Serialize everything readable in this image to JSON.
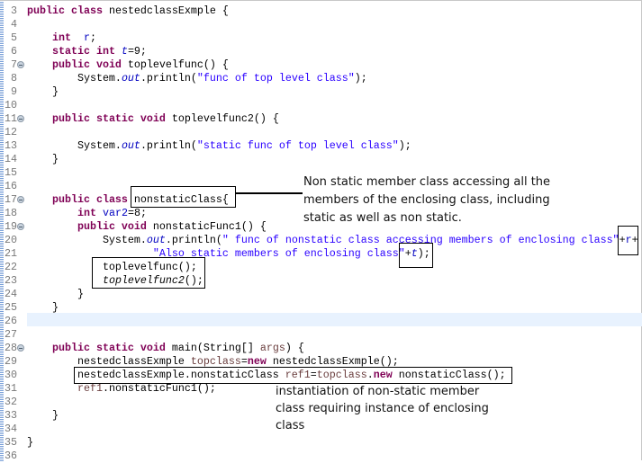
{
  "editor": {
    "highlighted_line": 26,
    "lines": [
      {
        "n": 3,
        "fold": false,
        "tokens": [
          [
            "kw",
            "public class"
          ],
          [
            "",
            "nestedclassExmple {"
          ]
        ]
      },
      {
        "n": 4,
        "fold": false,
        "tokens": []
      },
      {
        "n": 5,
        "fold": false,
        "tokens": [
          [
            "",
            "    "
          ],
          [
            "kw",
            "int"
          ],
          [
            "",
            ""
          ],
          [
            "fld",
            " r"
          ],
          [
            "",
            ";"
          ]
        ]
      },
      {
        "n": 6,
        "fold": false,
        "tokens": [
          [
            "",
            "    "
          ],
          [
            "kw",
            "static int"
          ],
          [
            "sfld",
            " t"
          ],
          [
            "",
            "=9;"
          ]
        ]
      },
      {
        "n": 7,
        "fold": true,
        "tokens": [
          [
            "",
            "    "
          ],
          [
            "kw",
            "public void"
          ],
          [
            "",
            " toplevelfunc() {"
          ]
        ]
      },
      {
        "n": 8,
        "fold": false,
        "tokens": [
          [
            "",
            "        System."
          ],
          [
            "sfld",
            "out"
          ],
          [
            "",
            ".println("
          ],
          [
            "str",
            "\"func of top level class\""
          ],
          [
            "",
            ");"
          ]
        ]
      },
      {
        "n": 9,
        "fold": false,
        "tokens": [
          [
            "",
            "    }"
          ]
        ]
      },
      {
        "n": 10,
        "fold": false,
        "tokens": []
      },
      {
        "n": 11,
        "fold": true,
        "tokens": [
          [
            "",
            "    "
          ],
          [
            "kw",
            "public static void"
          ],
          [
            "",
            " toplevelfunc2() {"
          ]
        ]
      },
      {
        "n": 12,
        "fold": false,
        "tokens": []
      },
      {
        "n": 13,
        "fold": false,
        "tokens": [
          [
            "",
            "        System."
          ],
          [
            "sfld",
            "out"
          ],
          [
            "",
            ".println("
          ],
          [
            "str",
            "\"static func of top level class\""
          ],
          [
            "",
            ");"
          ]
        ]
      },
      {
        "n": 14,
        "fold": false,
        "tokens": [
          [
            "",
            "    }"
          ]
        ]
      },
      {
        "n": 15,
        "fold": false,
        "tokens": []
      },
      {
        "n": 16,
        "fold": false,
        "tokens": []
      },
      {
        "n": 17,
        "fold": true,
        "tokens": [
          [
            "",
            "    "
          ],
          [
            "kw",
            "public class"
          ],
          [
            "",
            " nonstaticClass{"
          ]
        ]
      },
      {
        "n": 18,
        "fold": false,
        "tokens": [
          [
            "",
            "        "
          ],
          [
            "kw",
            "int"
          ],
          [
            "fld",
            " var2"
          ],
          [
            "",
            "=8;"
          ]
        ]
      },
      {
        "n": 19,
        "fold": true,
        "tokens": [
          [
            "",
            "        "
          ],
          [
            "kw",
            "public void"
          ],
          [
            "",
            " nonstaticFunc1() {"
          ]
        ]
      },
      {
        "n": 20,
        "fold": false,
        "tokens": [
          [
            "",
            "            System."
          ],
          [
            "sfld",
            "out"
          ],
          [
            "",
            ".println("
          ],
          [
            "str",
            "\" func of nonstatic class accessing members of enclosing class\""
          ],
          [
            "",
            "+"
          ],
          [
            "fld",
            "r"
          ],
          [
            "",
            "+"
          ]
        ]
      },
      {
        "n": 21,
        "fold": false,
        "tokens": [
          [
            "",
            "                    "
          ],
          [
            "str",
            "\"Also static members of enclosing class\""
          ],
          [
            "",
            "+"
          ],
          [
            "sfld",
            "t"
          ],
          [
            "",
            ");"
          ]
        ]
      },
      {
        "n": 22,
        "fold": false,
        "tokens": [
          [
            "",
            "            toplevelfunc();"
          ]
        ]
      },
      {
        "n": 23,
        "fold": false,
        "tokens": [
          [
            "",
            "            "
          ],
          [
            "it",
            "toplevelfunc2"
          ],
          [
            "",
            "();"
          ]
        ]
      },
      {
        "n": 24,
        "fold": false,
        "tokens": [
          [
            "",
            "        }"
          ]
        ]
      },
      {
        "n": 25,
        "fold": false,
        "tokens": [
          [
            "",
            "    }"
          ]
        ]
      },
      {
        "n": 26,
        "fold": false,
        "tokens": []
      },
      {
        "n": 27,
        "fold": false,
        "tokens": []
      },
      {
        "n": 28,
        "fold": true,
        "tokens": [
          [
            "",
            "    "
          ],
          [
            "kw",
            "public static void"
          ],
          [
            "",
            " main(String[] "
          ],
          [
            "loc",
            "args"
          ],
          [
            "",
            ") {"
          ]
        ]
      },
      {
        "n": 29,
        "fold": false,
        "tokens": [
          [
            "",
            "        nestedclassExmple "
          ],
          [
            "loc",
            "topclass"
          ],
          [
            "",
            "="
          ],
          [
            "kw",
            "new"
          ],
          [
            "",
            " nestedclassExmple();"
          ]
        ]
      },
      {
        "n": 30,
        "fold": false,
        "tokens": [
          [
            "",
            "        nestedclassExmple.nonstaticClass "
          ],
          [
            "loc",
            "ref1"
          ],
          [
            "",
            "="
          ],
          [
            "loc",
            "topclass"
          ],
          [
            "",
            "."
          ],
          [
            "kw",
            "new"
          ],
          [
            "",
            " nonstaticClass();"
          ]
        ]
      },
      {
        "n": 31,
        "fold": false,
        "tokens": [
          [
            "",
            "        "
          ],
          [
            "loc",
            "ref1"
          ],
          [
            "",
            ".nonstaticFunc1();"
          ]
        ]
      },
      {
        "n": 32,
        "fold": false,
        "tokens": []
      },
      {
        "n": 33,
        "fold": false,
        "tokens": [
          [
            "",
            "    }"
          ]
        ]
      },
      {
        "n": 34,
        "fold": false,
        "tokens": []
      },
      {
        "n": 35,
        "fold": false,
        "tokens": [
          [
            "",
            "}"
          ]
        ]
      },
      {
        "n": 36,
        "fold": false,
        "tokens": []
      }
    ]
  },
  "annotations": {
    "nonstatic_note": [
      "Non static member class accessing all the",
      "members of the enclosing class, including",
      "static as well as non static."
    ],
    "instantiation_note": [
      "instantiation of non-static member",
      "class requiring instance of enclosing",
      "class"
    ]
  }
}
